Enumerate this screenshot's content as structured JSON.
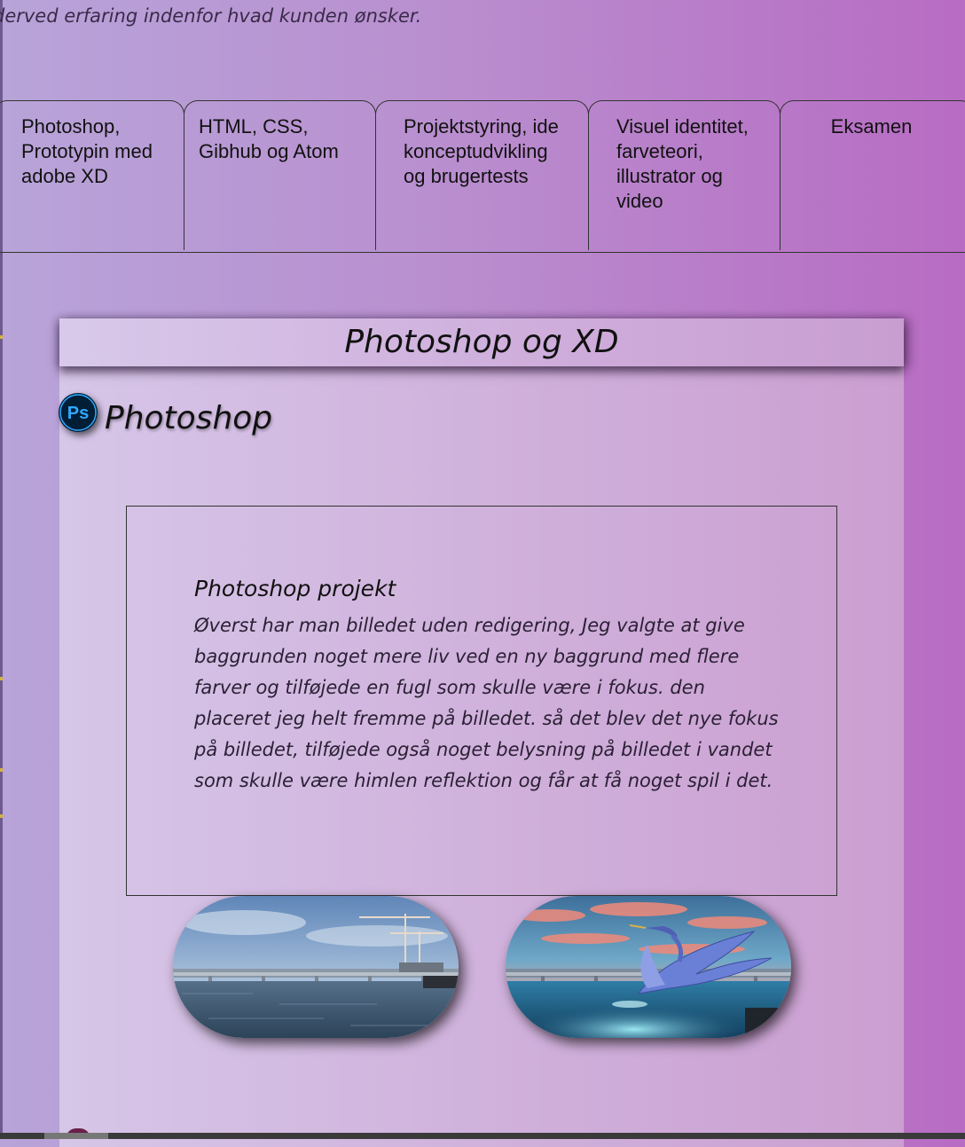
{
  "intro_text": "derved erfaring indenfor hvad kunden ønsker.",
  "tabs": [
    {
      "label": "Photoshop, Prototypin med adobe XD"
    },
    {
      "label": "HTML, CSS, Gibhub og Atom"
    },
    {
      "label": "Projektstyring, ide konceptudvikling og brugertests"
    },
    {
      "label": "Visuel identitet, farveteori, illustrator og video"
    },
    {
      "label": "Eksamen"
    }
  ],
  "card": {
    "header": "Photoshop og XD",
    "section_icon": "photoshop-icon",
    "section_icon_text": "Ps",
    "section_title": "Photoshop",
    "project": {
      "title": "Photoshop projekt",
      "text": "Øverst har man billedet uden redigering, Jeg valgte at give baggrunden noget mere liv ved en ny baggrund med flere farver og tilføjede en fugl som skulle være i fokus. den placeret jeg helt fremme på billedet. så det blev det nye fokus på billedet, tilføjede også noget belysning på billedet i vandet som skulle være himlen reflektion og får at få noget spil i det."
    },
    "images": [
      {
        "name": "original-harbor-photo"
      },
      {
        "name": "edited-harbor-photo-with-heron"
      }
    ]
  },
  "colors": {
    "background_start": "#b8a4d9",
    "background_end": "#b86cc3",
    "photoshop_blue": "#31a8ff",
    "photoshop_dark": "#001e36"
  }
}
